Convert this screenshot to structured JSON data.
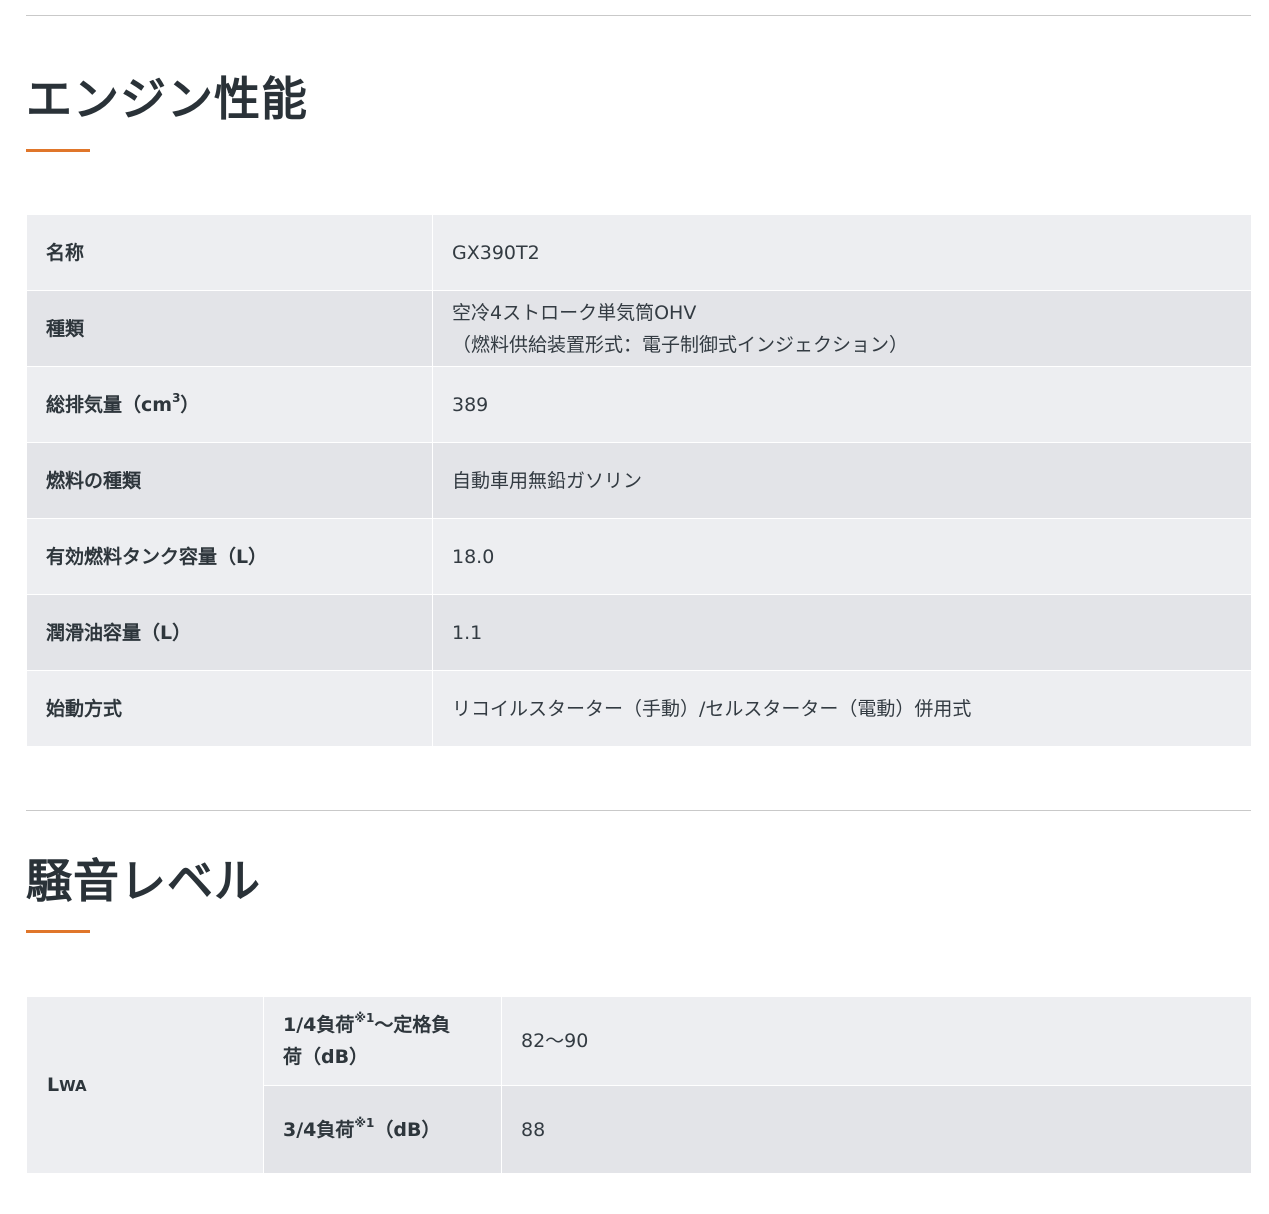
{
  "engine_section": {
    "title": "エンジン性能",
    "rows": [
      {
        "label": "名称",
        "value": "GX390T2"
      },
      {
        "label": "種類",
        "value_line1": "空冷4ストローク単気筒OHV",
        "value_line2": "（燃料供給装置形式：電子制御式インジェクション）"
      },
      {
        "label_prefix": "総排気量（cm",
        "label_sup": "3",
        "label_suffix": "）",
        "value": "389"
      },
      {
        "label": "燃料の種類",
        "value": "自動車用無鉛ガソリン"
      },
      {
        "label": "有効燃料タンク容量（L）",
        "value": "18.0"
      },
      {
        "label": "潤滑油容量（L）",
        "value": "1.1"
      },
      {
        "label": "始動方式",
        "value": "リコイルスターター（手動）/セルスターター（電動）併用式"
      }
    ]
  },
  "noise_section": {
    "title": "騒音レベル",
    "group_label_main": "L",
    "group_label_sub": "WA",
    "rows": [
      {
        "label_line1_prefix": "1/4負荷",
        "label_line1_sup": "※1",
        "label_line1_suffix": "～定格負",
        "label_line2": "荷（dB）",
        "value": "82～90"
      },
      {
        "label_prefix": "3/4負荷",
        "label_sup": "※1",
        "label_suffix": "（dB）",
        "value": "88"
      }
    ]
  },
  "colors": {
    "accent": "#e0762a",
    "heading": "#2a3238",
    "row_light": "#edeef1",
    "row_dark": "#e3e4e8",
    "rule": "#c9c9c9"
  }
}
